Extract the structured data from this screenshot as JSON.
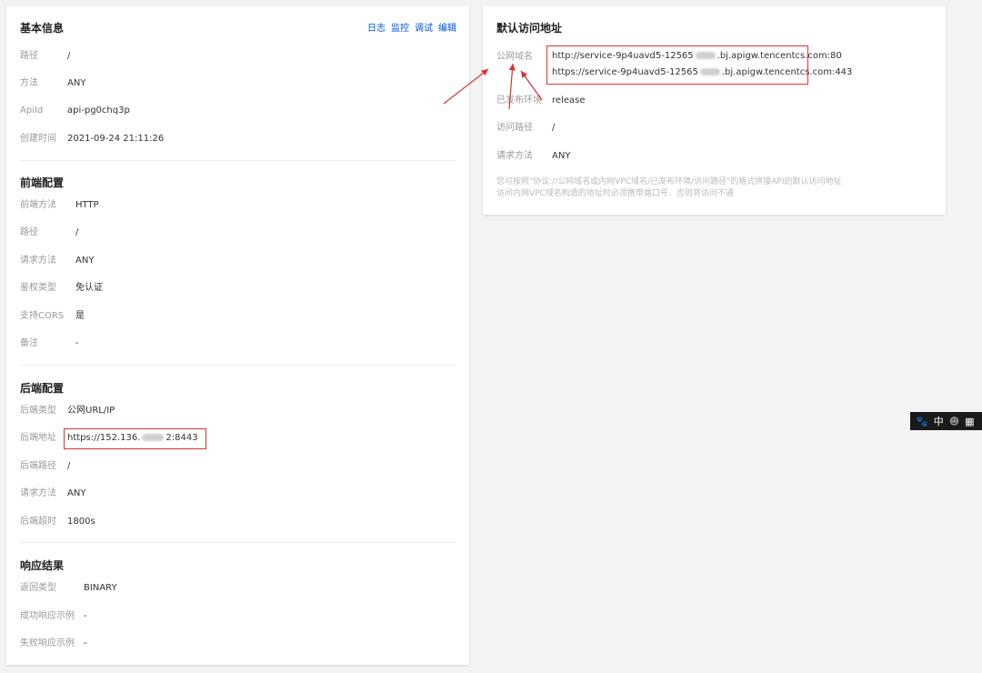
{
  "basic": {
    "title": "基本信息",
    "actions": [
      "日志",
      "监控",
      "调试",
      "编辑"
    ],
    "rows": [
      {
        "label": "路径",
        "value": "/"
      },
      {
        "label": "方法",
        "value": "ANY"
      },
      {
        "label": "ApiId",
        "value": "api-pg0chq3p"
      },
      {
        "label": "创建时间",
        "value": "2021-09-24 21:11:26"
      }
    ]
  },
  "frontend": {
    "title": "前端配置",
    "rows": [
      {
        "label": "前端方法",
        "value": "HTTP"
      },
      {
        "label": "路径",
        "value": "/"
      },
      {
        "label": "请求方法",
        "value": "ANY"
      },
      {
        "label": "鉴权类型",
        "value": "免认证"
      },
      {
        "label": "支持CORS",
        "value": "是"
      },
      {
        "label": "备注",
        "value": "-"
      }
    ]
  },
  "backend": {
    "title": "后端配置",
    "rows": [
      {
        "label": "后端类型",
        "value": "公网URL/IP"
      },
      {
        "label": "后端地址",
        "value_prefix": "https://152.136.",
        "value_suffix": "2:8443"
      },
      {
        "label": "后端路径",
        "value": "/"
      },
      {
        "label": "请求方法",
        "value": "ANY"
      },
      {
        "label": "后端超时",
        "value": "1800s"
      }
    ]
  },
  "response": {
    "title": "响应结果",
    "rows": [
      {
        "label": "返回类型",
        "value": "BINARY"
      },
      {
        "label": "成功响应示例",
        "value": "-"
      },
      {
        "label": "失败响应示例",
        "value": "-"
      }
    ]
  },
  "default_access": {
    "title": "默认访问地址",
    "domain_label": "公网域名",
    "url_http_prefix": "http://service-9p4uavd5-12565",
    "url_http_suffix": ".bj.apigw.tencentcs.com:80",
    "url_https_prefix": "https://service-9p4uavd5-12565",
    "url_https_suffix": ".bj.apigw.tencentcs.com:443",
    "rows": [
      {
        "label": "已发布环境",
        "value": "release"
      },
      {
        "label": "访问路径",
        "value": "/"
      },
      {
        "label": "请求方法",
        "value": "ANY"
      }
    ],
    "note_line1": "您可按照\"协议://公网域名或内网VPC域名/已发布环境/访问路径\"的格式拼接API的默认访问地址",
    "note_line2": "访问内网VPC域名构造的地址时必须携带端口号，否则将访问不通"
  },
  "ime_bar": {
    "lang": "中"
  }
}
